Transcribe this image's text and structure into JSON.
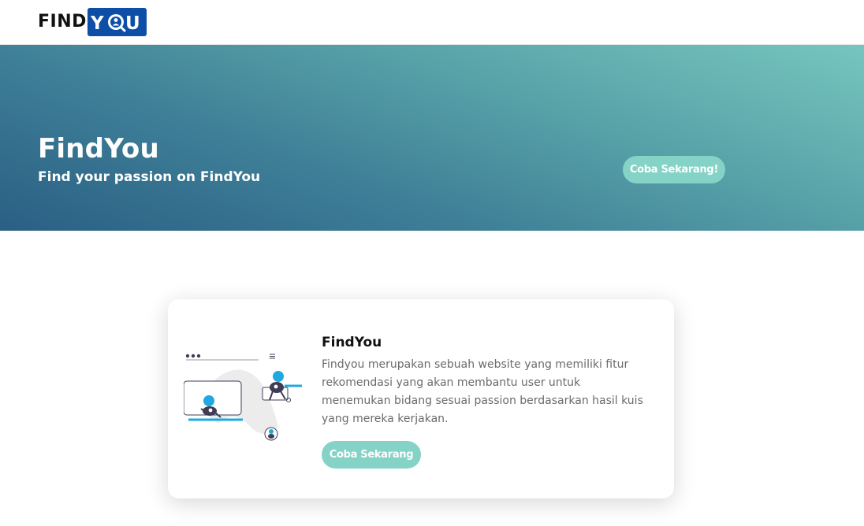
{
  "navbar": {
    "brand_find": "FIND",
    "brand_you": "YOU",
    "brand_color": "#0d4ea6"
  },
  "hero": {
    "title": "FindYou",
    "subtitle": "Find your passion on FindYou",
    "button_label": "Coba Sekarang!",
    "gradient_colors": [
      "#2a5f84",
      "#76c6bf"
    ]
  },
  "card": {
    "title": "FindYou",
    "description": "Findyou merupakan sebuah website yang memiliki fitur rekomendasi yang akan membantu user untuk menemukan bidang sesuai passion berdasarkan hasil kuis yang mereka kerjakan.",
    "button_label": "Coba Sekarang",
    "illustration": "people-searching-illustration"
  },
  "colors": {
    "accent_button": "#85d2c6",
    "illustration_accent": "#1fa9e1"
  }
}
